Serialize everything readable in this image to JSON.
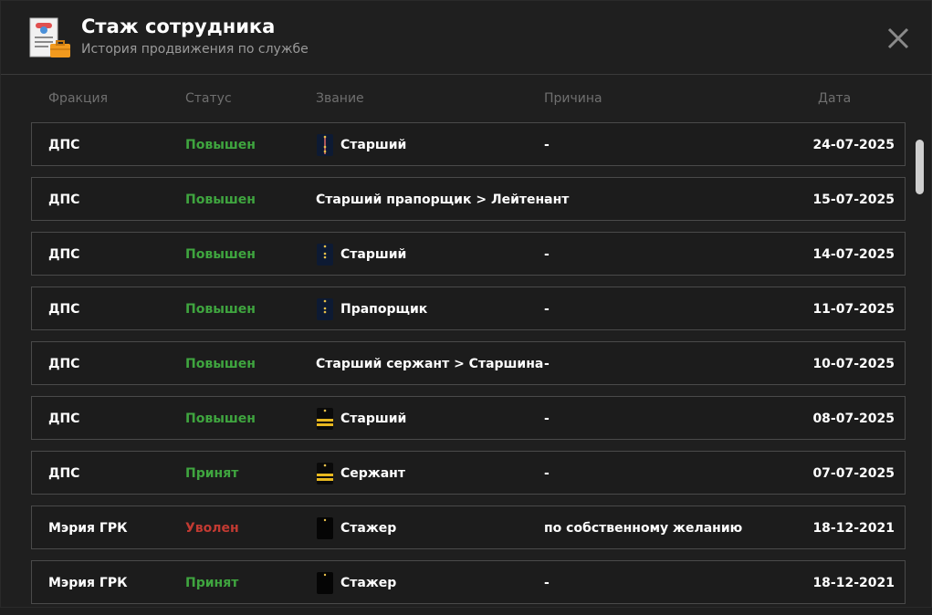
{
  "header": {
    "title": "Стаж сотрудника",
    "subtitle": "История продвижения по службе",
    "icon": "document-briefcase-icon"
  },
  "columns": {
    "faction": "Фракция",
    "status": "Статус",
    "rank": "Звание",
    "reason": "Причина",
    "date": "Дата"
  },
  "colors": {
    "promoted": "#3fa53f",
    "fired": "#c23a32",
    "background": "#1f1f1f",
    "border": "#4a4a4a"
  },
  "rows": [
    {
      "faction": "ДПС",
      "status": "Повышен",
      "status_type": "promoted",
      "rank": "Старший",
      "rank_icon": "shoulder-strap-stripe",
      "reason": "-",
      "date": "24-07-2025"
    },
    {
      "faction": "ДПС",
      "status": "Повышен",
      "status_type": "promoted",
      "rank": "Старший прапорщик > Лейтенант",
      "rank_icon": "",
      "reason": "-",
      "date": "15-07-2025"
    },
    {
      "faction": "ДПС",
      "status": "Повышен",
      "status_type": "promoted",
      "rank": "Старший",
      "rank_icon": "shoulder-strap-stars",
      "reason": "-",
      "date": "14-07-2025"
    },
    {
      "faction": "ДПС",
      "status": "Повышен",
      "status_type": "promoted",
      "rank": "Прапорщик",
      "rank_icon": "shoulder-strap-stars",
      "reason": "-",
      "date": "11-07-2025"
    },
    {
      "faction": "ДПС",
      "status": "Повышен",
      "status_type": "promoted",
      "rank": "Старший сержант > Старшина",
      "rank_icon": "",
      "reason": "-",
      "date": "10-07-2025"
    },
    {
      "faction": "ДПС",
      "status": "Повышен",
      "status_type": "promoted",
      "rank": "Старший",
      "rank_icon": "shoulder-strap-bars",
      "reason": "-",
      "date": "08-07-2025"
    },
    {
      "faction": "ДПС",
      "status": "Принят",
      "status_type": "hired",
      "rank": "Сержант",
      "rank_icon": "shoulder-strap-bars",
      "reason": "-",
      "date": "07-07-2025"
    },
    {
      "faction": "Мэрия ГРК",
      "status": "Уволен",
      "status_type": "fired",
      "rank": "Стажер",
      "rank_icon": "shoulder-strap-plain",
      "reason": "по собственному желанию",
      "date": "18-12-2021"
    },
    {
      "faction": "Мэрия ГРК",
      "status": "Принят",
      "status_type": "hired",
      "rank": "Стажер",
      "rank_icon": "shoulder-strap-plain",
      "reason": "-",
      "date": "18-12-2021"
    }
  ]
}
